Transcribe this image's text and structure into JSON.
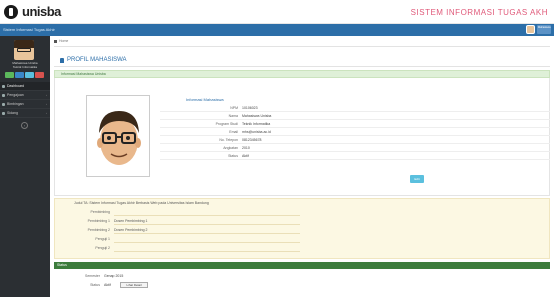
{
  "header": {
    "logo_text": "unisba",
    "system_title": "SISTEM INFORMASI TUGAS AKH"
  },
  "topbar": {
    "breadcrumb_text": "Sistem Informasi Tugas Akhir",
    "user_label": "Mahasiswa"
  },
  "sidebar": {
    "user_name": "Mahasiswa Unisba",
    "user_role": "Teknik Informatika",
    "items": [
      {
        "label": "Dashboard",
        "icon": "home-icon",
        "active": true
      },
      {
        "label": "Pengajuan",
        "icon": "file-icon",
        "active": false
      },
      {
        "label": "Bimbingan",
        "icon": "users-icon",
        "active": false
      },
      {
        "label": "Sidang",
        "icon": "calendar-icon",
        "active": false
      }
    ]
  },
  "breadcrumb": {
    "home": "Home"
  },
  "page": {
    "title": "PROFIL MAHASISWA"
  },
  "panel": {
    "heading": "Informasi Mahasiswa Unisba"
  },
  "profile": {
    "section_title": "Informasi Mahasiswa",
    "rows": [
      {
        "key": "NPM",
        "value": "10106023"
      },
      {
        "key": "Nama",
        "value": "Mahasiswa Unisba"
      },
      {
        "key": "Program Studi",
        "value": "Teknik Informatika"
      },
      {
        "key": "Email",
        "value": "mhs@unisba.ac.id"
      },
      {
        "key": "No. Telepon",
        "value": "0812345678"
      },
      {
        "key": "Angkatan",
        "value": "2010"
      },
      {
        "key": "Status",
        "value": "Aktif"
      }
    ],
    "edit_label": "Edit"
  },
  "note": {
    "heading": "Judul TA: Sistem Informasi Tugas Akhir Berbasis Web pada Universitas Islam Bandung",
    "rows": [
      {
        "key": "Pembimbing",
        "value": ""
      },
      {
        "key": "Pembimbing 1",
        "value": "Dosen Pembimbing 1"
      },
      {
        "key": "Pembimbing 2",
        "value": "Dosen Pembimbing 2"
      },
      {
        "key": "Penguji 1",
        "value": ""
      },
      {
        "key": "Penguji 2",
        "value": ""
      }
    ]
  },
  "status_section": {
    "title": "Status",
    "rows": [
      {
        "key": "Semester",
        "value": "Genap 2015"
      },
      {
        "key": "Status",
        "value": "Aktif"
      }
    ],
    "button_label": "Lihat Detail"
  },
  "colors": {
    "primary": "#2c6ea8",
    "sidebar": "#2b2f33",
    "success_bg": "#dff0d8",
    "warning_bg": "#fcf8e3",
    "green_bar": "#3c7c3c",
    "title_pink": "#e05a7a"
  }
}
